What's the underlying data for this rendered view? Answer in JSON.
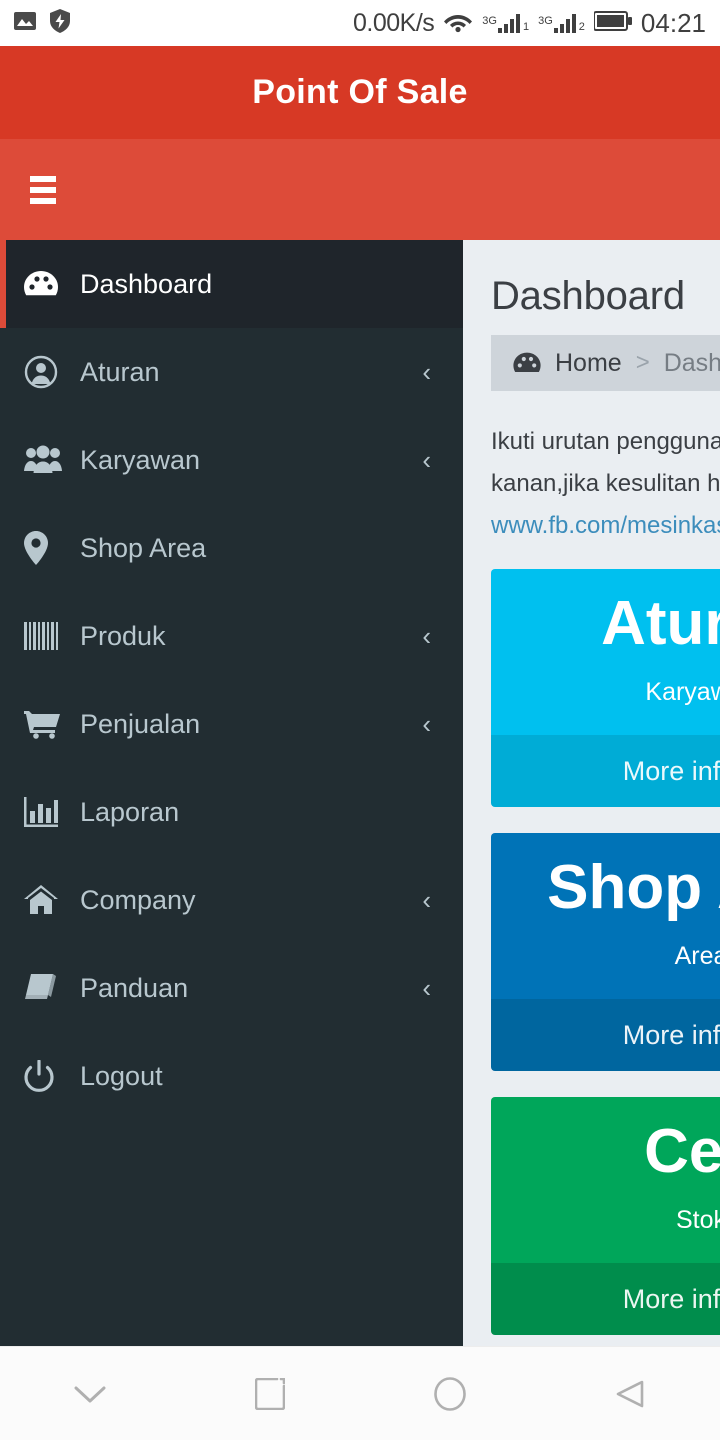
{
  "statusbar": {
    "network_speed": "0.00K/s",
    "time": "04:21",
    "sim1_label": "3G",
    "sim1_index": "1",
    "sim2_label": "3G",
    "sim2_index": "2",
    "icons": [
      "photo-icon",
      "shield-bolt-icon",
      "wifi-icon",
      "signal-icon",
      "battery-icon"
    ]
  },
  "header": {
    "title": "Point Of Sale",
    "bg_color": "#d73925"
  },
  "navbar": {
    "toggle_label": "",
    "bg_color": "#dd4b39"
  },
  "sidebar": {
    "bg_color": "#222d32",
    "active_accent": "#dd4b39",
    "items": [
      {
        "label": "Dashboard",
        "icon": "dashboard-icon",
        "active": true,
        "arrow": ""
      },
      {
        "label": "Aturan",
        "icon": "user-circle-icon",
        "active": false,
        "arrow": "‹"
      },
      {
        "label": "Karyawan",
        "icon": "users-icon",
        "active": false,
        "arrow": "‹"
      },
      {
        "label": "Shop Area",
        "icon": "map-pin-icon",
        "active": false,
        "arrow": ""
      },
      {
        "label": "Produk",
        "icon": "barcode-icon",
        "active": false,
        "arrow": "‹"
      },
      {
        "label": "Penjualan",
        "icon": "cart-icon",
        "active": false,
        "arrow": "‹"
      },
      {
        "label": "Laporan",
        "icon": "bar-chart-icon",
        "active": false,
        "arrow": ""
      },
      {
        "label": "Company",
        "icon": "home-icon",
        "active": false,
        "arrow": "‹"
      },
      {
        "label": "Panduan",
        "icon": "book-icon",
        "active": false,
        "arrow": "‹"
      },
      {
        "label": "Logout",
        "icon": "power-icon",
        "active": false,
        "arrow": ""
      }
    ]
  },
  "main": {
    "page_title": "Dashboard",
    "breadcrumb": {
      "icon": "dashboard-icon",
      "home": "Home",
      "separator": ">",
      "current": "Dashboard"
    },
    "intro": {
      "line1": "Ikuti urutan penggunaa",
      "line2": "kanan,jika kesulitan hu",
      "link": "www.fb.com/mesinkasi",
      "link_color": "#3c8dbc"
    },
    "cards": [
      {
        "title": "Aturan",
        "subtitle": "Karyawan",
        "footer": "More info",
        "footer_icon": "circle-arrow-right-icon",
        "color": "#00c0ef",
        "footer_color": "#00acd6",
        "theme": "cyan"
      },
      {
        "title": "Shop Area",
        "subtitle": "Area",
        "footer": "More info",
        "footer_icon": "circle-arrow-right-icon",
        "color": "#0073b7",
        "footer_color": "#00669f",
        "theme": "blue"
      },
      {
        "title": "Cek",
        "subtitle": "Stok",
        "footer": "More info",
        "footer_icon": "circle-arrow-right-icon",
        "color": "#00a65a",
        "footer_color": "#008d4c",
        "theme": "green"
      }
    ]
  },
  "android_nav": {
    "buttons": [
      {
        "name": "hide-keyboard-button",
        "icon": "chevron-down-icon"
      },
      {
        "name": "recents-button",
        "icon": "square-icon"
      },
      {
        "name": "home-button",
        "icon": "circle-icon"
      },
      {
        "name": "back-button",
        "icon": "triangle-left-icon"
      }
    ]
  }
}
